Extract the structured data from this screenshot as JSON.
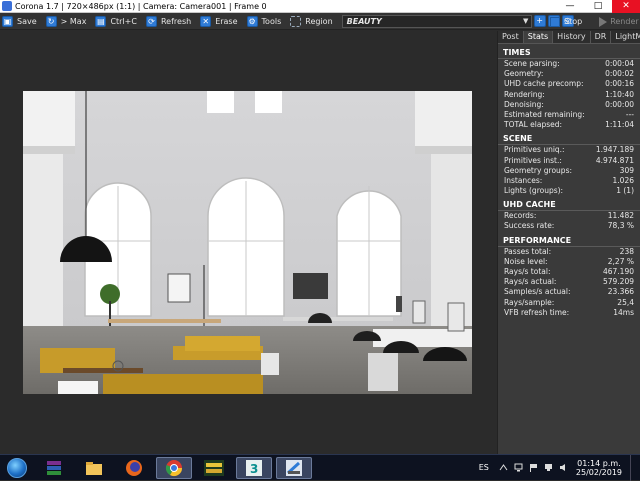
{
  "window": {
    "title": "Corona 1.7 | 720×486px (1:1) | Camera: Camera001 | Frame 0",
    "minimize": "—",
    "maximize": "□",
    "close": "✕"
  },
  "toolbar": {
    "save": "Save",
    "max": "> Max",
    "copy": "Ctrl+C",
    "refresh": "Refresh",
    "erase": "Erase",
    "tools": "Tools",
    "region": "Region",
    "pass": "BEAUTY",
    "stop": "Stop",
    "render": "Render"
  },
  "tabs": [
    "Post",
    "Stats",
    "History",
    "DR",
    "LightMix"
  ],
  "stats": {
    "times_title": "TIMES",
    "times": [
      {
        "k": "Scene parsing:",
        "v": "0:00:04"
      },
      {
        "k": "Geometry:",
        "v": "0:00:02"
      },
      {
        "k": "UHD cache precomp:",
        "v": "0:00:16"
      },
      {
        "k": "Rendering:",
        "v": "1:10:40"
      },
      {
        "k": "Denoising:",
        "v": "0:00:00"
      },
      {
        "k": "Estimated remaining:",
        "v": "---"
      },
      {
        "k": "TOTAL elapsed:",
        "v": "1:11:04"
      }
    ],
    "scene_title": "SCENE",
    "scene": [
      {
        "k": "Primitives uniq.:",
        "v": "1.947.189"
      },
      {
        "k": "Primitives inst.:",
        "v": "4.974.871"
      },
      {
        "k": "Geometry groups:",
        "v": "309"
      },
      {
        "k": "Instances:",
        "v": "1.026"
      },
      {
        "k": "Lights (groups):",
        "v": "1 (1)"
      }
    ],
    "uhd_title": "UHD CACHE",
    "uhd": [
      {
        "k": "Records:",
        "v": "11.482"
      },
      {
        "k": "Success rate:",
        "v": "78,3 %"
      }
    ],
    "perf_title": "PERFORMANCE",
    "perf": [
      {
        "k": "Passes total:",
        "v": "238"
      },
      {
        "k": "Noise level:",
        "v": "2,27 %"
      },
      {
        "k": "Rays/s total:",
        "v": "467.190"
      },
      {
        "k": "Rays/s actual:",
        "v": "579.209"
      },
      {
        "k": "Samples/s actual:",
        "v": "23.366"
      },
      {
        "k": "Rays/sample:",
        "v": "25,4"
      },
      {
        "k": "VFB refresh time:",
        "v": "14ms"
      }
    ]
  },
  "taskbar": {
    "lang": "ES",
    "time": "01:14 p.m.",
    "date": "25/02/2019",
    "apps": [
      "winrar-icon",
      "folder-icon",
      "firefox-icon",
      "chrome-icon",
      "game-icon",
      "3dsmax-icon",
      "corona-vfb-icon"
    ]
  },
  "colors": {
    "accent": "#2f7bd6",
    "panel": "#3a3a3a",
    "toolbar": "#333333",
    "taskbar": "#0d1220"
  }
}
